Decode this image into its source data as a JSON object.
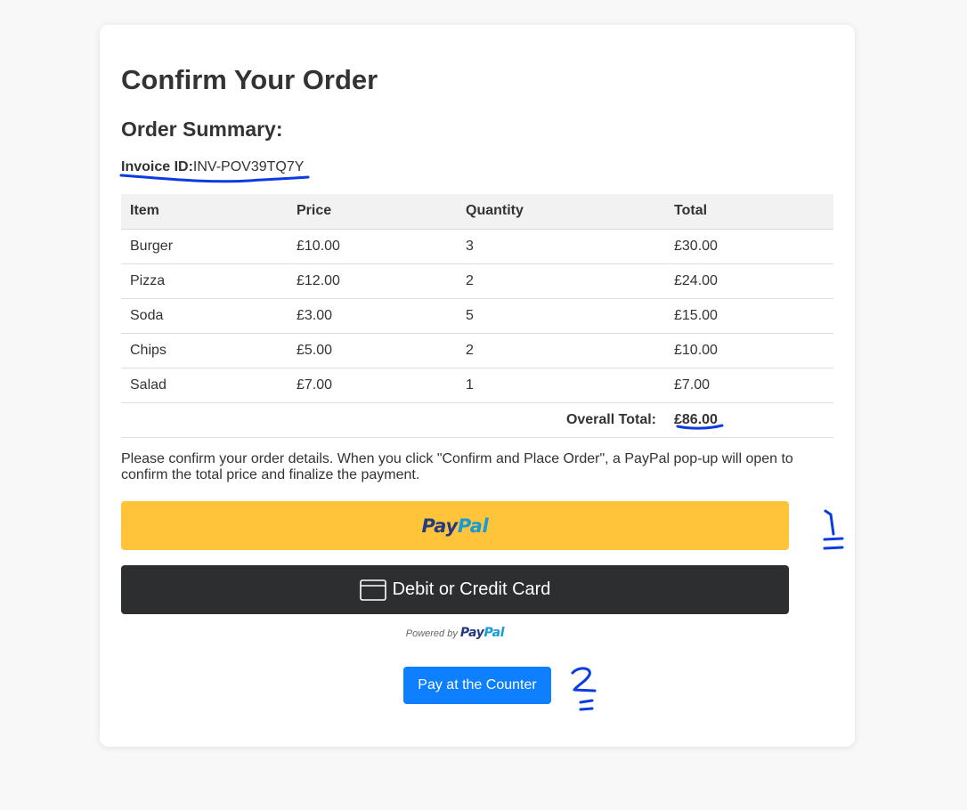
{
  "header": {
    "title": "Confirm Your Order",
    "subtitle": "Order Summary:"
  },
  "invoice": {
    "label": "Invoice ID:",
    "value": "INV-POV39TQ7Y"
  },
  "table": {
    "columns": [
      "Item",
      "Price",
      "Quantity",
      "Total"
    ],
    "rows": [
      [
        "Burger",
        "£10.00",
        "3",
        "£30.00"
      ],
      [
        "Pizza",
        "£12.00",
        "2",
        "£24.00"
      ],
      [
        "Soda",
        "£3.00",
        "5",
        "£15.00"
      ],
      [
        "Chips",
        "£5.00",
        "2",
        "£10.00"
      ],
      [
        "Salad",
        "£7.00",
        "1",
        "£7.00"
      ]
    ],
    "overall_label": "Overall Total:",
    "overall_value": "£86.00"
  },
  "note": "Please confirm your order details. When you click \"Confirm and Place Order\", a PayPal pop-up will open to confirm the total price and finalize the payment.",
  "paypal": {
    "logo_a": "Pay",
    "logo_b": "Pal",
    "card_label": "Debit or Credit Card",
    "card_icon": "credit-card-icon",
    "powered_by": "Powered by"
  },
  "counter": {
    "label": "Pay at the Counter"
  },
  "annotations": {
    "one": "1",
    "two": "2"
  },
  "colors": {
    "paypal_yellow": "#ffc439",
    "card_dark": "#2c2e2f",
    "counter_blue": "#0d7fff",
    "ink_blue": "#0a3ce0"
  }
}
